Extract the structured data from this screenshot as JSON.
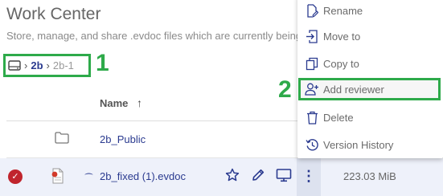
{
  "header": {
    "title": "Work Center",
    "subtitle": "Store, manage, and share .evdoc files which are currently being"
  },
  "breadcrumb": {
    "items": [
      "2b",
      "2b-1"
    ]
  },
  "annotations": {
    "one": "1",
    "two": "2"
  },
  "table": {
    "columns": {
      "name": "Name"
    },
    "rows": [
      {
        "type": "folder",
        "name": "2b_Public"
      },
      {
        "type": "file",
        "name": "2b_fixed (1).evdoc",
        "size": "223.03 MiB",
        "selected": true
      }
    ]
  },
  "context_menu": {
    "items": [
      {
        "label": "Rename",
        "icon": "rename-icon"
      },
      {
        "label": "Move to",
        "icon": "move-to-icon"
      },
      {
        "label": "Copy to",
        "icon": "copy-icon"
      },
      {
        "label": "Add reviewer",
        "icon": "add-reviewer-icon"
      },
      {
        "label": "Delete",
        "icon": "trash-icon"
      },
      {
        "label": "Version History",
        "icon": "history-icon"
      }
    ]
  },
  "colors": {
    "accent": "#2a3a8f",
    "highlight_box": "#2eaa4a",
    "check": "#c0242d"
  }
}
